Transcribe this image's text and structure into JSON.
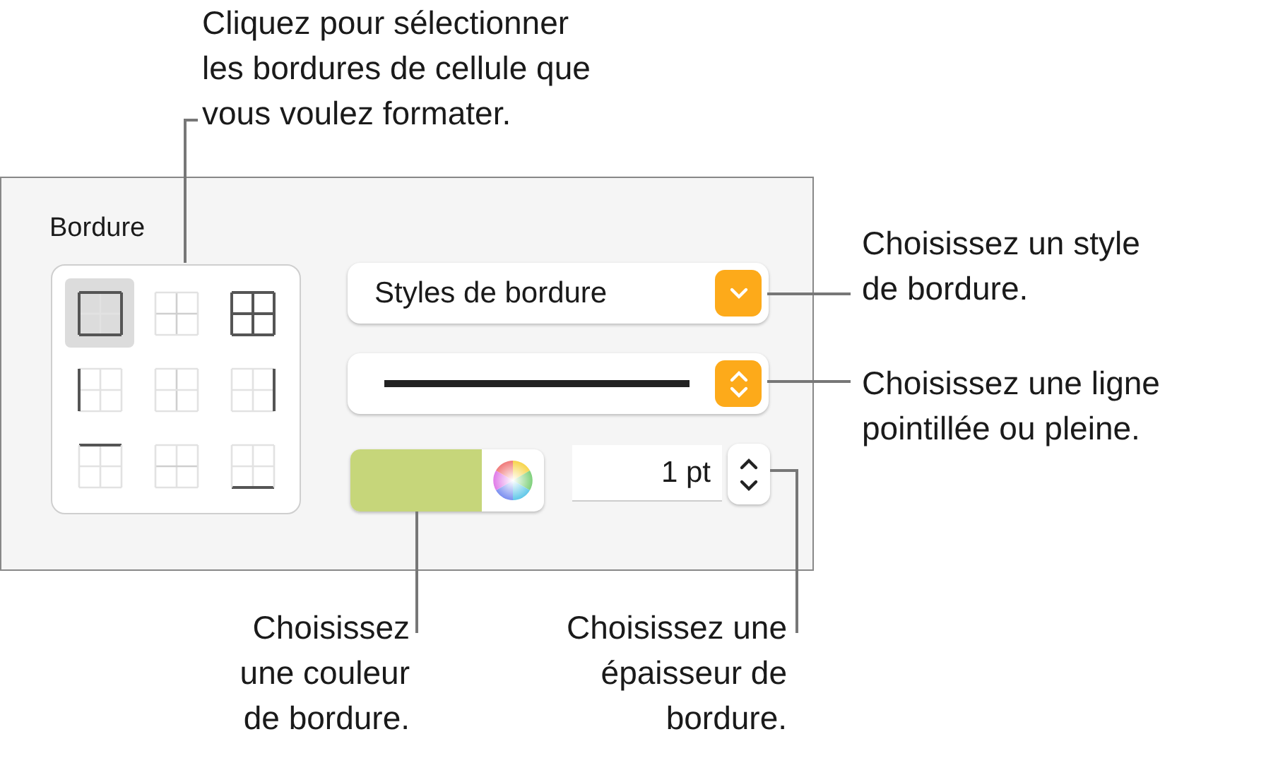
{
  "callouts": [
    {
      "lines": [
        "Cliquez pour sélectionner",
        "les bordures de cellule que",
        "vous voulez formater."
      ]
    },
    {
      "lines": [
        "Choisissez un style",
        "de bordure."
      ]
    },
    {
      "lines": [
        "Choisissez une ligne",
        "pointillée ou pleine."
      ]
    },
    {
      "lines": [
        "Choisissez",
        "une couleur",
        "de bordure."
      ]
    },
    {
      "lines": [
        "Choisissez une",
        "épaisseur de",
        "bordure."
      ]
    }
  ],
  "panel": {
    "title": "Bordure",
    "border_buttons": [
      {
        "kind": "outer",
        "selected": true
      },
      {
        "kind": "inner",
        "selected": false
      },
      {
        "kind": "all",
        "selected": false
      },
      {
        "kind": "left",
        "selected": false
      },
      {
        "kind": "vertical",
        "selected": false
      },
      {
        "kind": "right",
        "selected": false
      },
      {
        "kind": "top",
        "selected": false
      },
      {
        "kind": "horizontal",
        "selected": false
      },
      {
        "kind": "bottom",
        "selected": false
      }
    ],
    "style_popup": {
      "value": "Styles de bordure"
    },
    "line_popup": {
      "kind": "solid"
    },
    "color_well": {
      "color": "#c6d67a"
    },
    "width_field": {
      "value": "1 pt"
    }
  }
}
